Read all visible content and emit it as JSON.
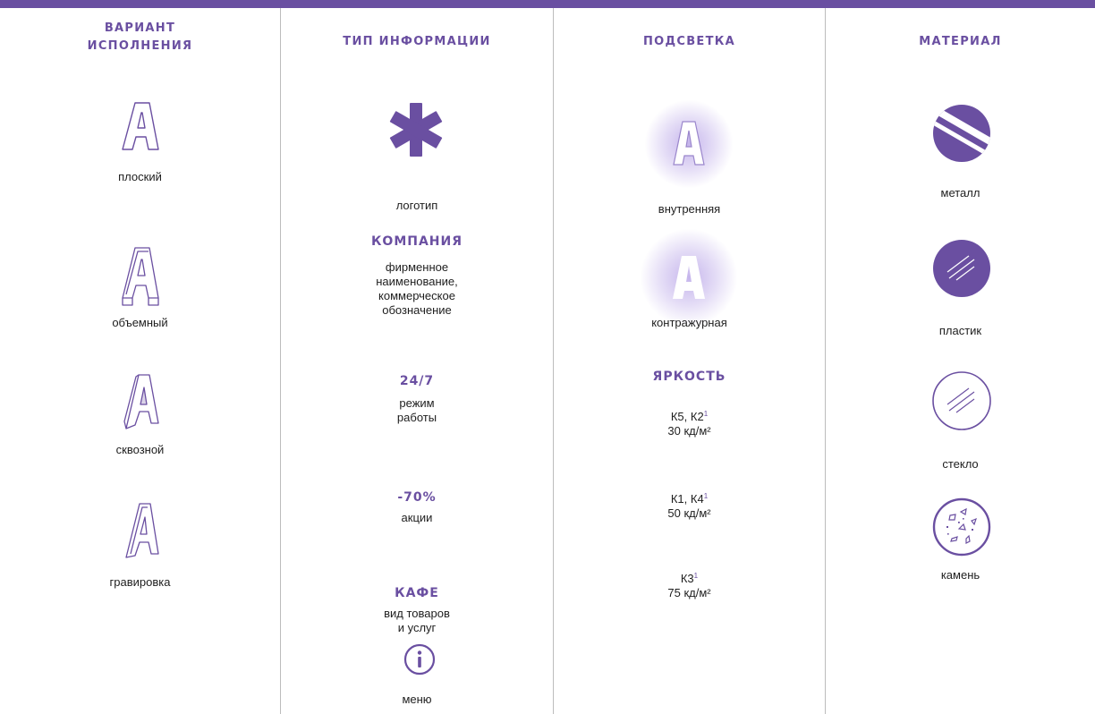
{
  "colors": {
    "accent": "#6a4fa1",
    "divider": "#bcbcbc",
    "text": "#1e1e1e"
  },
  "columns": {
    "variant": {
      "header_line1": "ВАРИАНТ",
      "header_line2": "ИСПОЛНЕНИЯ",
      "items": [
        {
          "icon": "flat-letter-a-icon",
          "label": "плоский"
        },
        {
          "icon": "volumetric-letter-a-icon",
          "label": "объемный"
        },
        {
          "icon": "through-letter-a-icon",
          "label": "сквозной"
        },
        {
          "icon": "engraved-letter-a-icon",
          "label": "гравировка"
        }
      ]
    },
    "info_type": {
      "header": "ТИП ИНФОРМАЦИИ",
      "logo_icon": "asterisk-icon",
      "logo_label": "логотип",
      "company_title": "КОМПАНИЯ",
      "company_lines": [
        "фирменное",
        "наименование,",
        "коммерческое",
        "обозначение"
      ],
      "hours_title": "24/7",
      "hours_lines": [
        "режим",
        "работы"
      ],
      "promo_title": "-70%",
      "promo_label": "акции",
      "cafe_title": "КАФЕ",
      "cafe_lines": [
        "вид товаров",
        "и услуг"
      ],
      "menu_icon": "info-icon",
      "menu_label": "меню"
    },
    "lighting": {
      "header": "ПОДСВЕТКА",
      "items": [
        {
          "icon": "internal-glow-letter-a-icon",
          "label": "внутренняя"
        },
        {
          "icon": "backlit-letter-a-icon",
          "label": "контражурная"
        }
      ],
      "brightness_title": "ЯРКОСТЬ",
      "brightness": [
        {
          "classes": "К5, К2",
          "note": "1",
          "value": "30 кд/м²"
        },
        {
          "classes": "К1, К4",
          "note": "1",
          "value": "50 кд/м²"
        },
        {
          "classes": "К3",
          "note": "1",
          "value": "75 кд/м²"
        }
      ]
    },
    "material": {
      "header": "МАТЕРИАЛ",
      "items": [
        {
          "icon": "metal-icon",
          "label": "металл"
        },
        {
          "icon": "plastic-icon",
          "label": "пластик"
        },
        {
          "icon": "glass-icon",
          "label": "стекло"
        },
        {
          "icon": "stone-icon",
          "label": "камень"
        }
      ]
    }
  }
}
